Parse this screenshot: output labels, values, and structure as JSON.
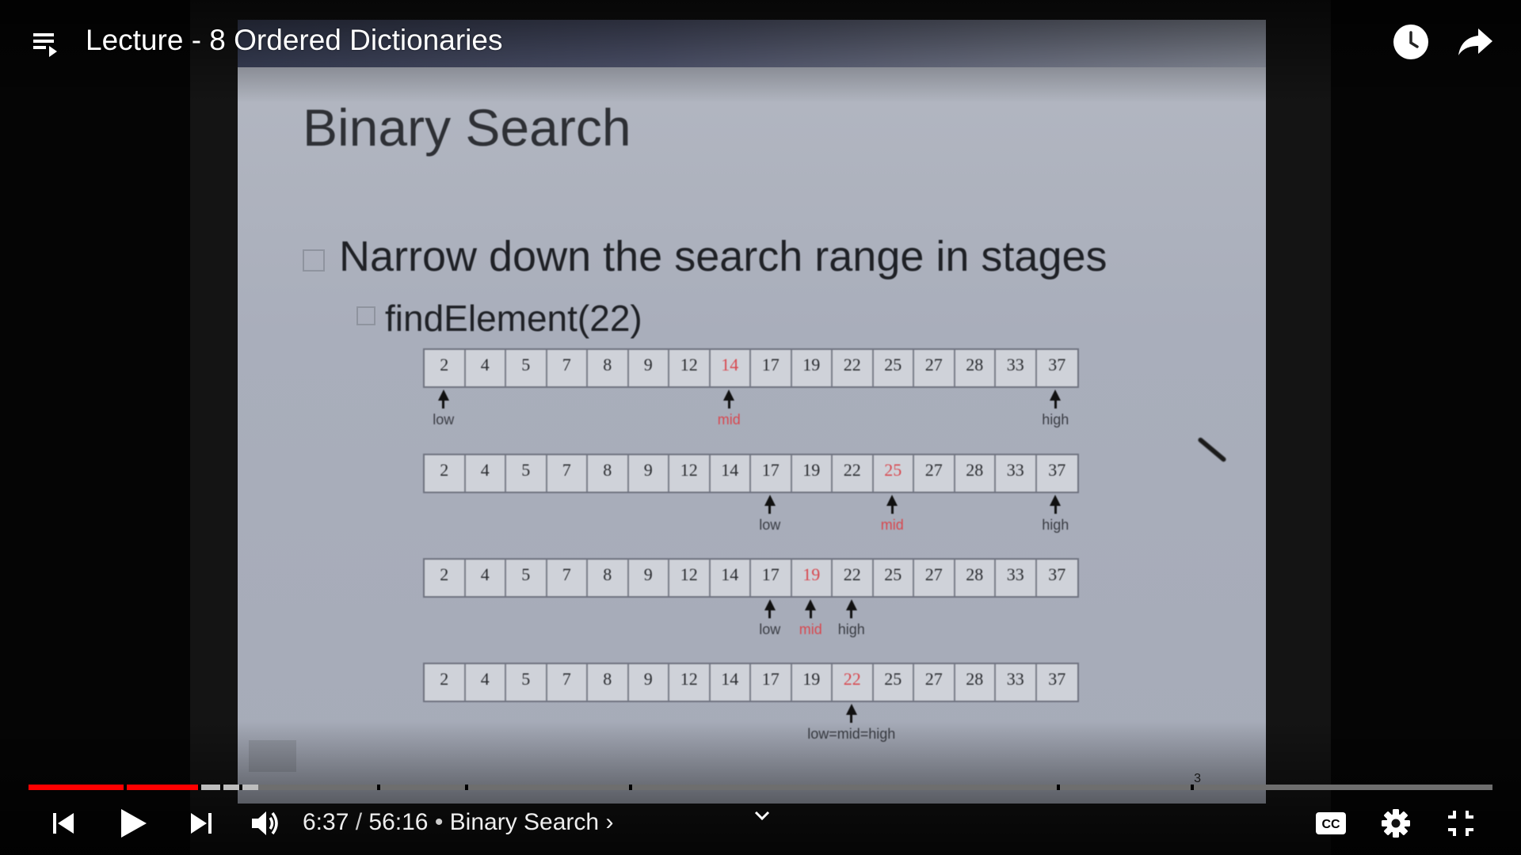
{
  "header": {
    "title": "Lecture - 8 Ordered Dictionaries",
    "playlist_icon": "playlist-icon",
    "watch_later_icon": "clock-icon",
    "share_icon": "share-arrow-icon"
  },
  "slide": {
    "title": "Binary Search",
    "bullet_1": "Narrow down the search range in stages",
    "bullet_2": "findElement(22)",
    "rows": [
      {
        "cells": [
          "2",
          "4",
          "5",
          "7",
          "8",
          "9",
          "12",
          "14",
          "17",
          "19",
          "22",
          "25",
          "27",
          "28",
          "33",
          "37"
        ],
        "highlight": 7,
        "pointers": [
          {
            "label": "low",
            "index": 0,
            "red": false
          },
          {
            "label": "mid",
            "index": 7,
            "red": true
          },
          {
            "label": "high",
            "index": 15,
            "red": false
          }
        ]
      },
      {
        "cells": [
          "2",
          "4",
          "5",
          "7",
          "8",
          "9",
          "12",
          "14",
          "17",
          "19",
          "22",
          "25",
          "27",
          "28",
          "33",
          "37"
        ],
        "highlight": 11,
        "pointers": [
          {
            "label": "low",
            "index": 8,
            "red": false
          },
          {
            "label": "mid",
            "index": 11,
            "red": true
          },
          {
            "label": "high",
            "index": 15,
            "red": false
          }
        ]
      },
      {
        "cells": [
          "2",
          "4",
          "5",
          "7",
          "8",
          "9",
          "12",
          "14",
          "17",
          "19",
          "22",
          "25",
          "27",
          "28",
          "33",
          "37"
        ],
        "highlight": 9,
        "pointers": [
          {
            "label": "low",
            "index": 8,
            "red": false
          },
          {
            "label": "mid",
            "index": 9,
            "red": true
          },
          {
            "label": "high",
            "index": 10,
            "red": false
          }
        ]
      },
      {
        "cells": [
          "2",
          "4",
          "5",
          "7",
          "8",
          "9",
          "12",
          "14",
          "17",
          "19",
          "22",
          "25",
          "27",
          "28",
          "33",
          "37"
        ],
        "highlight": 10,
        "pointers": [
          {
            "label": "low=mid=high",
            "index": 10,
            "red": false
          }
        ]
      }
    ],
    "slide_number": "3"
  },
  "player": {
    "current_time": "6:37",
    "duration": "56:16",
    "separator": " / ",
    "bullet": " • ",
    "chapter": "Binary Search",
    "chapter_arrow": "›",
    "progress_played_fraction": 0.118,
    "colors": {
      "played": "#ff0000",
      "buffered": "#bdbdbd",
      "track": "#6e6e6e"
    },
    "icons": {
      "previous": "skip-previous-icon",
      "play": "play-icon",
      "next": "skip-next-icon",
      "volume": "volume-icon",
      "captions": "closed-captions-icon",
      "settings": "gear-icon",
      "exit_fullscreen": "exit-fullscreen-icon"
    }
  }
}
